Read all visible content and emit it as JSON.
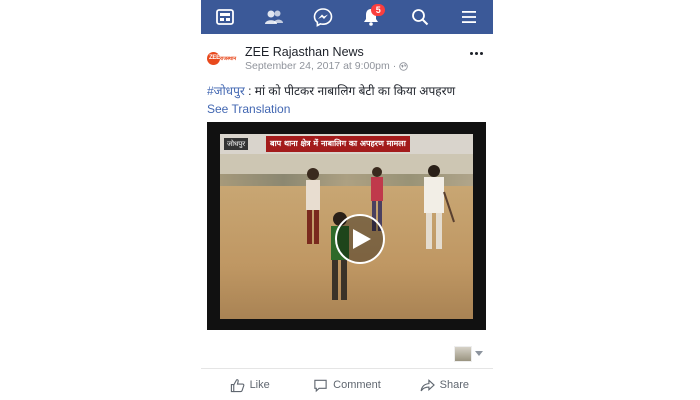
{
  "topbar": {
    "icons": [
      "news-feed-icon",
      "friends-icon",
      "messenger-icon",
      "notifications-icon",
      "search-icon",
      "menu-icon"
    ],
    "notification_count": "5",
    "bg_color": "#3b5998"
  },
  "post": {
    "page_name": "ZEE Rajasthan News",
    "timestamp": "September 24, 2017 at 9:00pm",
    "privacy_icon": "globe-icon",
    "hashtag": "#जोधपुर",
    "text": " : मां को पीटकर नाबालिग बेटी का किया अपहरण",
    "see_translation": "See Translation",
    "video": {
      "tag": "जोधपुर",
      "headline": "बाप थाना क्षेत्र में नाबालिग का अपहरण मामला"
    }
  },
  "actions": {
    "like": "Like",
    "comment": "Comment",
    "share": "Share"
  },
  "colors": {
    "link": "#4267b2",
    "text": "#1d2129",
    "meta": "#90949c"
  }
}
